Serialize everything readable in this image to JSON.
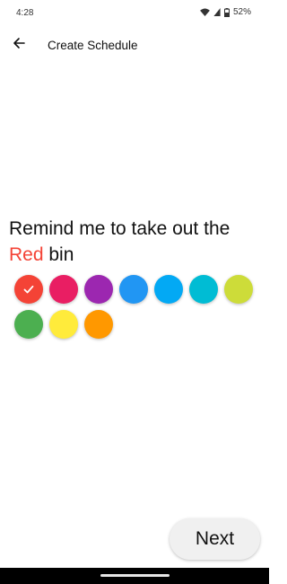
{
  "status_bar": {
    "time": "4:28",
    "battery": "52%",
    "icons": [
      "wifi-icon",
      "signal-icon",
      "battery-icon"
    ]
  },
  "app_bar": {
    "back_icon": "arrow-left-icon",
    "title": "Create Schedule"
  },
  "headline": {
    "prefix": "Remind me to take out the",
    "color_word": "Red",
    "suffix": "bin"
  },
  "colors": {
    "selected": "red",
    "options": [
      {
        "id": "red",
        "hex": "#F44336"
      },
      {
        "id": "pink",
        "hex": "#E91E63"
      },
      {
        "id": "purple",
        "hex": "#9C27B0"
      },
      {
        "id": "blue",
        "hex": "#2196F3"
      },
      {
        "id": "light-blue",
        "hex": "#03A9F4"
      },
      {
        "id": "cyan",
        "hex": "#00BCD4"
      },
      {
        "id": "lime",
        "hex": "#CDDC39"
      },
      {
        "id": "green",
        "hex": "#4CAF50"
      },
      {
        "id": "yellow",
        "hex": "#FFEB3B"
      },
      {
        "id": "orange",
        "hex": "#FF9800"
      }
    ],
    "check_icon": "checkmark-icon"
  },
  "actions": {
    "next_label": "Next"
  },
  "theme": {
    "accent": "#F44336",
    "button_bg": "#F0F0F0",
    "nav_bar": "#000000"
  }
}
